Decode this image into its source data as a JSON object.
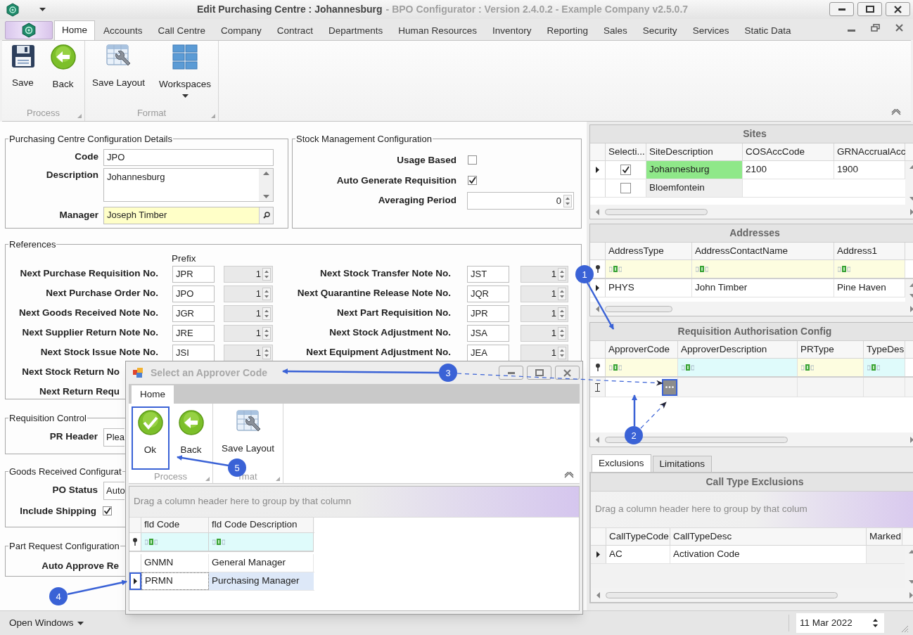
{
  "window": {
    "title": "Edit Purchasing Centre : Johannesburg",
    "subtitle": "- BPO Configurator : Version 2.4.0.2 - Example Company v2.5.0.7"
  },
  "ribbon_tabs": [
    {
      "label": "Home",
      "selected": true
    },
    {
      "label": "Accounts",
      "selected": false
    },
    {
      "label": "Call Centre",
      "selected": false
    },
    {
      "label": "Company",
      "selected": false
    },
    {
      "label": "Contract",
      "selected": false
    },
    {
      "label": "Departments",
      "selected": false
    },
    {
      "label": "Human Resources",
      "selected": false
    },
    {
      "label": "Inventory",
      "selected": false
    },
    {
      "label": "Reporting",
      "selected": false
    },
    {
      "label": "Sales",
      "selected": false
    },
    {
      "label": "Security",
      "selected": false
    },
    {
      "label": "Services",
      "selected": false
    },
    {
      "label": "Static Data",
      "selected": false
    }
  ],
  "ribbon_groups": [
    {
      "label": "Process",
      "buttons": [
        {
          "label": "Save",
          "kind": "save"
        },
        {
          "label": "Back",
          "kind": "back"
        }
      ]
    },
    {
      "label": "Format",
      "buttons": [
        {
          "label": "Save Layout",
          "kind": "layout"
        },
        {
          "label": "Workspaces",
          "kind": "workspaces",
          "dropdown": true
        }
      ]
    }
  ],
  "details": {
    "title": "Purchasing Centre Configuration Details",
    "fields": [
      {
        "label": "Code",
        "kind": "text",
        "value": "JPO"
      },
      {
        "label": "Description",
        "kind": "memo",
        "value": "Johannesburg"
      },
      {
        "label": "Manager",
        "kind": "lookup",
        "value": "Joseph Timber"
      }
    ]
  },
  "stock": {
    "title": "Stock Management Configuration",
    "fields": [
      {
        "label": "Usage Based",
        "kind": "checkbox",
        "checked": false
      },
      {
        "label": "Auto Generate Requisition",
        "kind": "checkbox",
        "checked": true
      },
      {
        "label": "Averaging Period",
        "kind": "spin",
        "value": "0"
      }
    ]
  },
  "references": {
    "title": "References",
    "prefix_heading": "Prefix",
    "left": [
      {
        "label": "Next Purchase Requisition No.",
        "prefix": "JPR",
        "number": "1"
      },
      {
        "label": "Next Purchase Order No.",
        "prefix": "JPO",
        "number": "1"
      },
      {
        "label": "Next Goods Received Note No.",
        "prefix": "JGR",
        "number": "1"
      },
      {
        "label": "Next Supplier Return Note No.",
        "prefix": "JRE",
        "number": "1"
      },
      {
        "label": "Next Stock Issue Note No.",
        "prefix": "JSI",
        "number": "1"
      },
      {
        "label": "Next Stock Return No"
      },
      {
        "label": "Next Return Requ"
      }
    ],
    "right": [
      {
        "label": "Next Stock Transfer Note No.",
        "prefix": "JST",
        "number": "1"
      },
      {
        "label": "Next Quarantine Release Note No.",
        "prefix": "JQR",
        "number": "1"
      },
      {
        "label": "Next Part Requisition No.",
        "prefix": "JPR",
        "number": "1"
      },
      {
        "label": "Next Stock Adjustment No.",
        "prefix": "JSA",
        "number": "1"
      },
      {
        "label": "Next Equipment Adjustment No.",
        "prefix": "JEA",
        "number": "1"
      }
    ]
  },
  "lower_groups": [
    {
      "title": "Requisition Control",
      "fields": [
        {
          "label": "PR Header",
          "kind": "text",
          "value": "Plea"
        }
      ]
    },
    {
      "title": "Goods Received Configurat",
      "fields": [
        {
          "label": "PO Status",
          "kind": "text",
          "value": "Auto"
        },
        {
          "label": "Include Shipping",
          "kind": "checkbox",
          "checked": true
        }
      ]
    },
    {
      "title": "Part Request Configuration",
      "fields": [
        {
          "label": "Auto Approve Re",
          "kind": "label"
        }
      ]
    }
  ],
  "sites": {
    "title": "Sites",
    "columns": [
      "Selecti...",
      "SiteDescription",
      "COSAccCode",
      "GRNAccrualAcc"
    ],
    "rows": [
      {
        "current": true,
        "checked": true,
        "highlighted": true,
        "cells": [
          "",
          "Johannesburg",
          "2100",
          "1900"
        ]
      },
      {
        "current": false,
        "checked": false,
        "highlighted": false,
        "cells": [
          "",
          "Bloemfontein"
        ]
      }
    ]
  },
  "addresses": {
    "title": "Addresses",
    "columns": [
      "AddressType",
      "AddressContactName",
      "Address1"
    ],
    "filter_row": true,
    "rows": [
      {
        "current": true,
        "cells": [
          "PHYS",
          "John Timber",
          "Pine Haven"
        ]
      }
    ]
  },
  "requisition_authorisation": {
    "title": "Requisition Authorisation Config",
    "columns": [
      "ApproverCode",
      "ApproverDescription",
      "PRType",
      "TypeDes"
    ],
    "filter_row": true,
    "new_row": {
      "button_highlighted": true
    }
  },
  "detail_tabs": [
    {
      "label": "Exclusions",
      "selected": true
    },
    {
      "label": "Limitations",
      "selected": false
    }
  ],
  "call_type_exclusions": {
    "title": "Call Type Exclusions",
    "group_panel": "Drag a column header here to group by that colum",
    "columns": [
      "CallTypeCode",
      "CallTypeDesc",
      "Marked"
    ],
    "rows": [
      {
        "current": true,
        "cells": [
          "AC",
          "Activation Code"
        ]
      }
    ]
  },
  "dialog": {
    "title": "Select an Approver Code",
    "tabs": [
      {
        "label": "Home",
        "selected": true
      }
    ],
    "groups": [
      {
        "label": "Process",
        "buttons": [
          {
            "label": "Ok",
            "kind": "ok",
            "highlighted": true
          },
          {
            "label": "Back",
            "kind": "back",
            "highlighted": false
          }
        ]
      },
      {
        "label": "rmat",
        "buttons": [
          {
            "label": "Save Layout",
            "kind": "layout",
            "highlighted": false
          }
        ]
      }
    ],
    "grid": {
      "group_panel": "Drag a column header here to group by that column",
      "columns": [
        "fld Code",
        "fld Code Description"
      ],
      "filter_row": true,
      "rows": [
        {
          "cells": [
            "GNMN",
            "General Manager"
          ],
          "selected": false,
          "highlighted": false
        },
        {
          "cells": [
            "PRMN",
            "Purchasing Manager"
          ],
          "selected": true,
          "highlighted": true
        }
      ]
    }
  },
  "status_bar": {
    "menu": "Open Windows",
    "date": "11 Mar 2022"
  },
  "callouts": [
    {
      "label": "1"
    },
    {
      "label": "2"
    },
    {
      "label": "3"
    },
    {
      "label": "4"
    },
    {
      "label": "5"
    }
  ]
}
